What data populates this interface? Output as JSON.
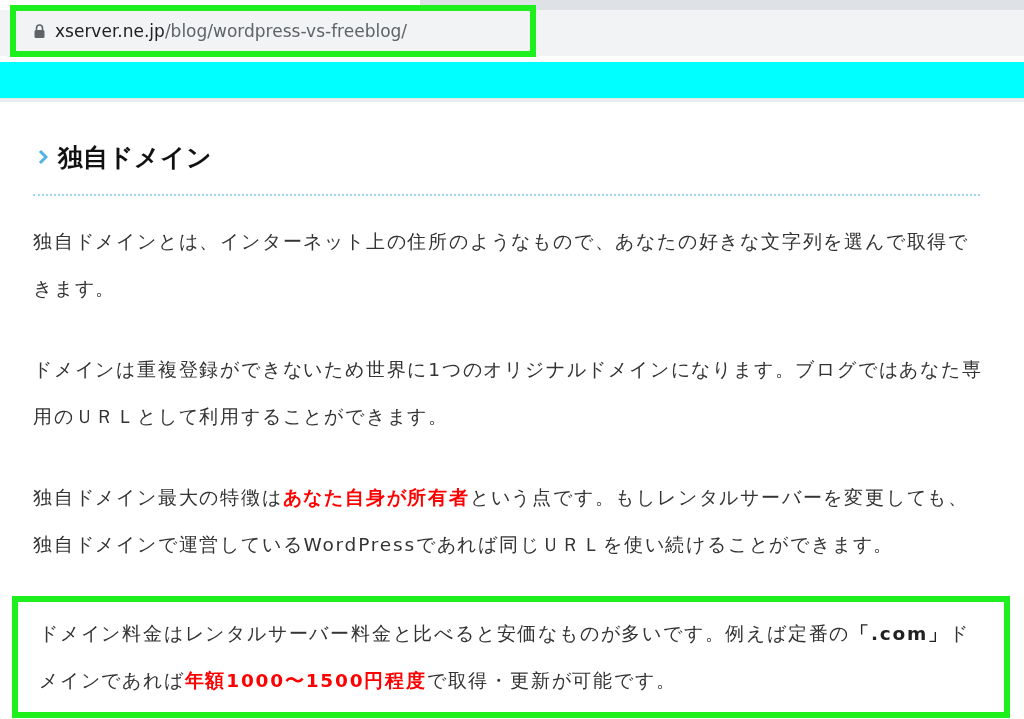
{
  "address_bar": {
    "host": "xserver.ne.jp",
    "path": "/blog/wordpress-vs-freeblog/",
    "highlighted": true
  },
  "article": {
    "heading": "独自ドメイン",
    "paragraphs": [
      {
        "highlighted": false,
        "segments": [
          {
            "kind": "plain",
            "text": "独自ドメインとは、インターネット上の住所のようなもので、あなたの好きな文字列を選んで取得できます。"
          }
        ]
      },
      {
        "highlighted": false,
        "segments": [
          {
            "kind": "plain",
            "text": "ドメインは重複登録ができないため世界に1つのオリジナルドメインになります。ブログではあなた専用のＵＲＬとして利用することができます。"
          }
        ]
      },
      {
        "highlighted": false,
        "segments": [
          {
            "kind": "plain",
            "text": "独自ドメイン最大の特徴は"
          },
          {
            "kind": "red",
            "text": "あなた自身が所有者"
          },
          {
            "kind": "plain",
            "text": "という点です。もしレンタルサーバーを変更しても、独自ドメインで運営しているWordPressであれば同じＵＲＬを使い続けることができます。"
          }
        ]
      },
      {
        "highlighted": true,
        "segments": [
          {
            "kind": "plain",
            "text": "ドメイン料金はレンタルサーバー料金と比べると安価なものが多いです。例えば定番の"
          },
          {
            "kind": "bold",
            "text": "「.com」"
          },
          {
            "kind": "plain",
            "text": "ドメインであれば"
          },
          {
            "kind": "red",
            "text": "年額1000〜1500円程度"
          },
          {
            "kind": "plain",
            "text": "で取得・更新が可能です。"
          }
        ]
      }
    ]
  }
}
